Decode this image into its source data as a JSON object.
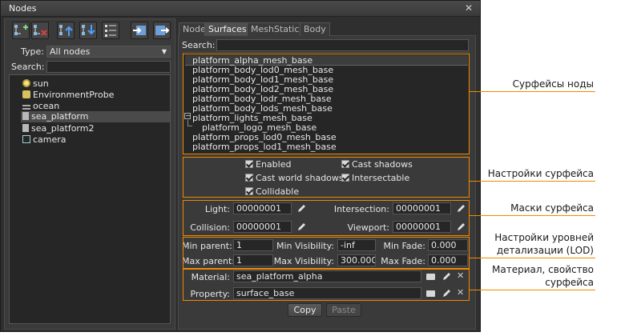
{
  "window": {
    "title": "Nodes",
    "close_icon": "close-icon"
  },
  "toolbar": {
    "buttons": [
      "add-node-icon",
      "remove-node-icon",
      "move-up-icon",
      "move-down-icon",
      "list-view-icon",
      "import-icon",
      "export-icon"
    ]
  },
  "left": {
    "type_label": "Type:",
    "type_value": "All nodes",
    "search_label": "Search:",
    "search_value": "",
    "nodes": [
      {
        "label": "sun",
        "icon": "light-icon"
      },
      {
        "label": "EnvironmentProbe",
        "icon": "probe-icon"
      },
      {
        "label": "ocean",
        "icon": "water-icon"
      },
      {
        "label": "sea_platform",
        "icon": "mesh-icon",
        "selected": true
      },
      {
        "label": "sea_platform2",
        "icon": "mesh-icon"
      },
      {
        "label": "camera",
        "icon": "camera-icon"
      }
    ]
  },
  "tabs": [
    "Node",
    "Surfaces",
    "MeshStatic",
    "Body"
  ],
  "active_tab": "Surfaces",
  "surfaces": {
    "search_label": "Search:",
    "search_value": "",
    "items": [
      "platform_alpha_mesh_base",
      "platform_body_lod0_mesh_base",
      "platform_body_lod1_mesh_base",
      "platform_body_lod2_mesh_base",
      "platform_body_lodr_mesh_base",
      "platform_body_lods_mesh_base",
      "platform_lights_mesh_base",
      "platform_logo_mesh_base",
      "platform_props_lod0_mesh_base",
      "platform_props_lod1_mesh_base"
    ],
    "collapse_symbol": "−"
  },
  "flags": {
    "enabled": "Enabled",
    "cast_shadows": "Cast shadows",
    "cast_world_shadows": "Cast world shadows",
    "intersectable": "Intersectable",
    "collidable": "Collidable"
  },
  "masks": {
    "light_label": "Light:",
    "light_value": "00000001",
    "intersection_label": "Intersection:",
    "intersection_value": "00000001",
    "collision_label": "Collision:",
    "collision_value": "00000001",
    "viewport_label": "Viewport:",
    "viewport_value": "00000001"
  },
  "lod": {
    "min_parent_label": "Min parent:",
    "min_parent_value": "1",
    "min_visibility_label": "Min Visibility:",
    "min_visibility_value": "-inf",
    "min_fade_label": "Min Fade:",
    "min_fade_value": "0.000",
    "max_parent_label": "Max parent:",
    "max_parent_value": "1",
    "max_visibility_label": "Max Visibility:",
    "max_visibility_value": "300.000",
    "max_fade_label": "Max Fade:",
    "max_fade_value": "0.000"
  },
  "material": {
    "material_label": "Material:",
    "material_value": "sea_platform_alpha",
    "property_label": "Property:",
    "property_value": "surface_base"
  },
  "buttons": {
    "copy": "Copy",
    "paste": "Paste"
  },
  "annotations": {
    "surfaces": "Сурфейсы ноды",
    "settings": "Настройки сурфейса",
    "masks": "Маски сурфейса",
    "lod_line1": "Настройки уровней",
    "lod_line2": "детализации (LOD)",
    "material_line1": "Материал, свойство",
    "material_line2": "сурфейса"
  },
  "colors": {
    "accent": "#f08a00",
    "panel": "#3a3a3a",
    "field": "#262626"
  }
}
